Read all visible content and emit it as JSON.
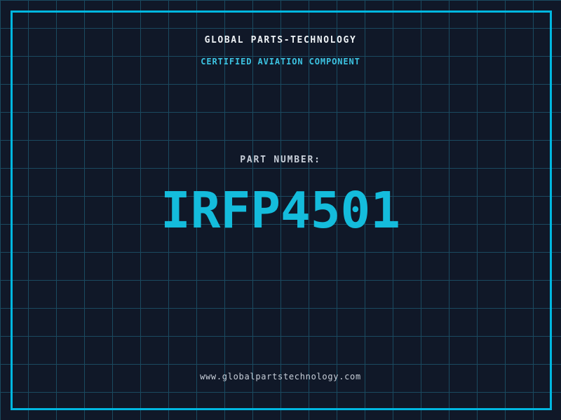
{
  "brand": {
    "title": "GLOBAL PARTS-TECHNOLOGY",
    "subtitle": "CERTIFIED AVIATION COMPONENT"
  },
  "part": {
    "label": "PART NUMBER:",
    "number": "IRFP4501"
  },
  "footer": {
    "website": "www.globalpartstechnology.com"
  },
  "colors": {
    "background": "#101828",
    "grid_line": "#1a4a60",
    "frame_border": "#00b7e0",
    "part_number_accent": "#14bcdc",
    "subtitle_cyan": "#3cc3e2",
    "title_white": "#eef2f5",
    "muted_gray": "#c7ced8"
  },
  "layout_meta": {
    "grid_cell_px": "40"
  }
}
